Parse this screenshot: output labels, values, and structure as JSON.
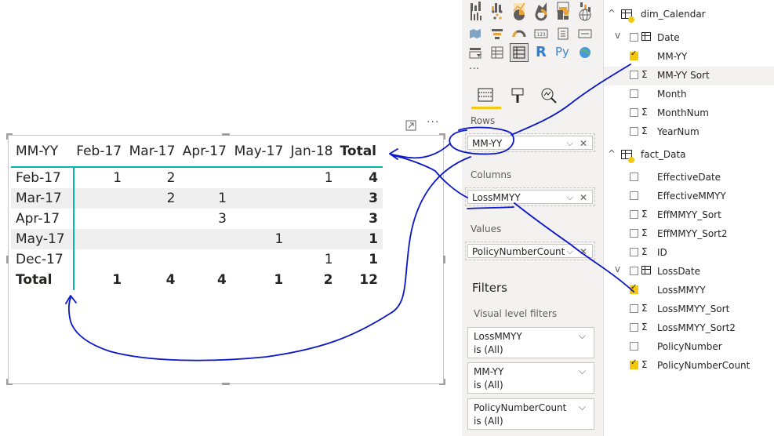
{
  "matrix": {
    "row_header": "MM-YY",
    "columns": [
      "Feb-17",
      "Mar-17",
      "Apr-17",
      "May-17",
      "Jan-18"
    ],
    "total_label": "Total",
    "rows": [
      {
        "label": "Feb-17",
        "cells": [
          "1",
          "2",
          "",
          "",
          "1"
        ],
        "total": "4"
      },
      {
        "label": "Mar-17",
        "cells": [
          "",
          "2",
          "1",
          "",
          ""
        ],
        "total": "3"
      },
      {
        "label": "Apr-17",
        "cells": [
          "",
          "",
          "3",
          "",
          ""
        ],
        "total": "3"
      },
      {
        "label": "May-17",
        "cells": [
          "",
          "",
          "",
          "1",
          ""
        ],
        "total": "1"
      },
      {
        "label": "Dec-17",
        "cells": [
          "",
          "",
          "",
          "",
          "1"
        ],
        "total": "1"
      }
    ],
    "grand_total": {
      "label": "Total",
      "cells": [
        "1",
        "4",
        "4",
        "1",
        "2"
      ],
      "total": "12"
    }
  },
  "visual_header": {
    "focus_icon": "focus-mode-icon",
    "more_icon": "more-options-icon",
    "more_glyph": "···"
  },
  "viz_pane": {
    "more_glyph": "···",
    "r_label": "R",
    "py_label": "Py",
    "tabs": [
      "fields-tab-icon",
      "format-tab-icon",
      "analytics-tab-icon"
    ],
    "rows_label": "Rows",
    "rows_field": "MM-YY",
    "columns_label": "Columns",
    "columns_field": "LossMMYY",
    "values_label": "Values",
    "values_field": "PolicyNumberCount",
    "filters_title": "Filters",
    "visual_filters_label": "Visual level filters",
    "filters": [
      {
        "name": "LossMMYY",
        "state": "is (All)"
      },
      {
        "name": "MM-YY",
        "state": "is (All)"
      },
      {
        "name": "PolicyNumberCount",
        "state": "is (All)"
      }
    ]
  },
  "fields": {
    "tables": [
      {
        "name": "dim_Calendar",
        "fields": [
          {
            "name": "Date",
            "kind": "date",
            "checked": false
          },
          {
            "name": "MM-YY",
            "kind": "text",
            "checked": true
          },
          {
            "name": "MM-YY Sort",
            "kind": "sum",
            "checked": false
          },
          {
            "name": "Month",
            "kind": "text",
            "checked": false
          },
          {
            "name": "MonthNum",
            "kind": "sum",
            "checked": false
          },
          {
            "name": "YearNum",
            "kind": "sum",
            "checked": false
          }
        ]
      },
      {
        "name": "fact_Data",
        "fields": [
          {
            "name": "EffectiveDate",
            "kind": "text",
            "checked": false
          },
          {
            "name": "EffectiveMMYY",
            "kind": "text",
            "checked": false
          },
          {
            "name": "EffMMYY_Sort",
            "kind": "sum",
            "checked": false
          },
          {
            "name": "EffMMYY_Sort2",
            "kind": "sum",
            "checked": false
          },
          {
            "name": "ID",
            "kind": "sum",
            "checked": false
          },
          {
            "name": "LossDate",
            "kind": "date",
            "checked": false
          },
          {
            "name": "LossMMYY",
            "kind": "text",
            "checked": true
          },
          {
            "name": "LossMMYY_Sort",
            "kind": "sum",
            "checked": false
          },
          {
            "name": "LossMMYY_Sort2",
            "kind": "sum",
            "checked": false
          },
          {
            "name": "PolicyNumber",
            "kind": "text",
            "checked": false
          },
          {
            "name": "PolicyNumberCount",
            "kind": "sum",
            "checked": true
          }
        ]
      }
    ]
  },
  "colors": {
    "accent": "#01b8aa",
    "check": "#f2c811",
    "annotation": "#0a16c8",
    "tab_underline": "#f2c811"
  }
}
